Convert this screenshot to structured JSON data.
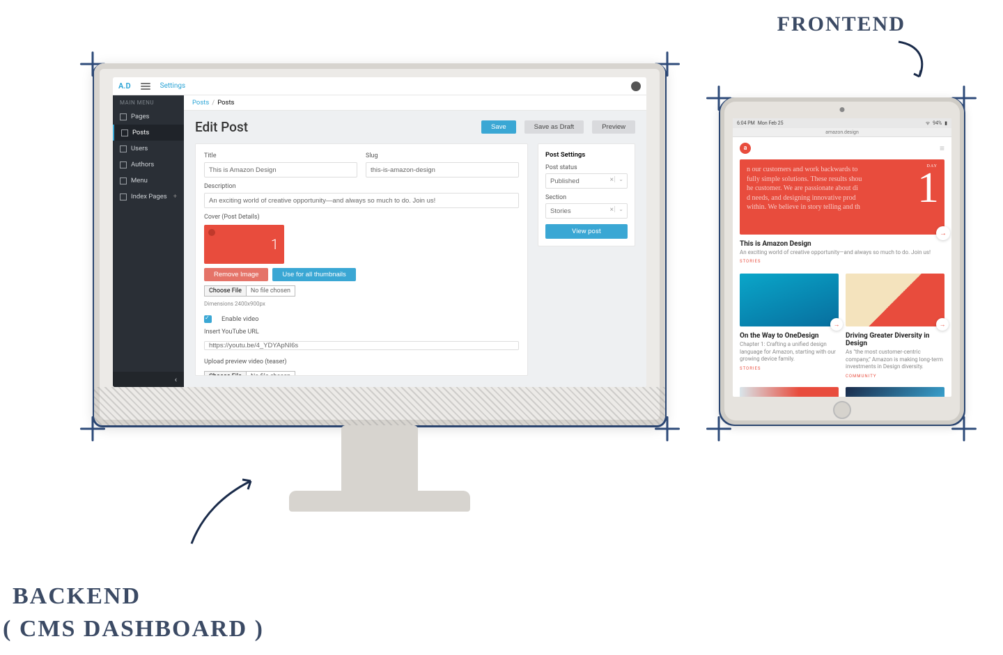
{
  "labels": {
    "frontend": "FRONTEND",
    "backend_line1": "BACKEND",
    "backend_line2": "( CMS DASHBOARD )"
  },
  "cms": {
    "brand": "A.D",
    "top_link": "Settings",
    "sidebar": {
      "header": "MAIN MENU",
      "items": [
        {
          "label": "Pages"
        },
        {
          "label": "Posts"
        },
        {
          "label": "Users"
        },
        {
          "label": "Authors"
        },
        {
          "label": "Menu"
        },
        {
          "label": "Index Pages"
        }
      ],
      "collapse_glyph": "‹"
    },
    "breadcrumbs": {
      "root": "Posts",
      "sep": "/",
      "current": "Posts"
    },
    "page_title": "Edit Post",
    "actions": {
      "save": "Save",
      "draft": "Save as Draft",
      "preview": "Preview"
    },
    "form": {
      "title_label": "Title",
      "title_value": "This is Amazon Design",
      "slug_label": "Slug",
      "slug_value": "this-is-amazon-design",
      "desc_label": "Description",
      "desc_value": "An exciting world of creative opportunity—and always so much to do. Join us!",
      "cover_label": "Cover (Post Details)",
      "cover_big_number": "1",
      "remove_image": "Remove Image",
      "use_all_thumbs": "Use for all thumbnails",
      "choose_file": "Choose File",
      "no_file": "No file chosen",
      "dimensions": "Dimensions 2400x900px",
      "enable_video": "Enable video",
      "insert_url_label": "Insert YouTube URL",
      "youtube_url": "https://youtu.be/4_YDYApNI6s",
      "upload_teaser_label": "Upload preview video (teaser)"
    },
    "settings": {
      "header": "Post Settings",
      "status_label": "Post status",
      "status_value": "Published",
      "section_label": "Section",
      "section_value": "Stories",
      "view_post": "View post"
    }
  },
  "frontend": {
    "status": {
      "time": "6:04 PM",
      "date": "Mon Feb 25",
      "wifi": "94%"
    },
    "url": "amazon.design",
    "logo_letter": "a",
    "hero": {
      "day_label": "DAY",
      "big_number": "1",
      "text_line1": "n our customers and work backwards to",
      "text_line2": "fully simple solutions. These results shou",
      "text_line3": "he customer. We are passionate about di",
      "text_line4": "d needs, and designing innovative prod",
      "text_line5": "within. We believe in story telling and th"
    },
    "post1": {
      "title": "This is Amazon Design",
      "sub": "An exciting world of creative opportunity—and always so much to do. Join us!",
      "tag": "STORIES"
    },
    "cards": [
      {
        "title": "On the Way to OneDesign",
        "sub": "Chapter 1: Crafting a unified design language for Amazon, starting with our growing device family.",
        "tag": "STORIES"
      },
      {
        "title": "Driving Greater Diversity in Design",
        "sub": "As \"the most customer-centric company,\" Amazon is making long-term investments in Design diversity.",
        "tag": "COMMUNITY"
      }
    ]
  }
}
